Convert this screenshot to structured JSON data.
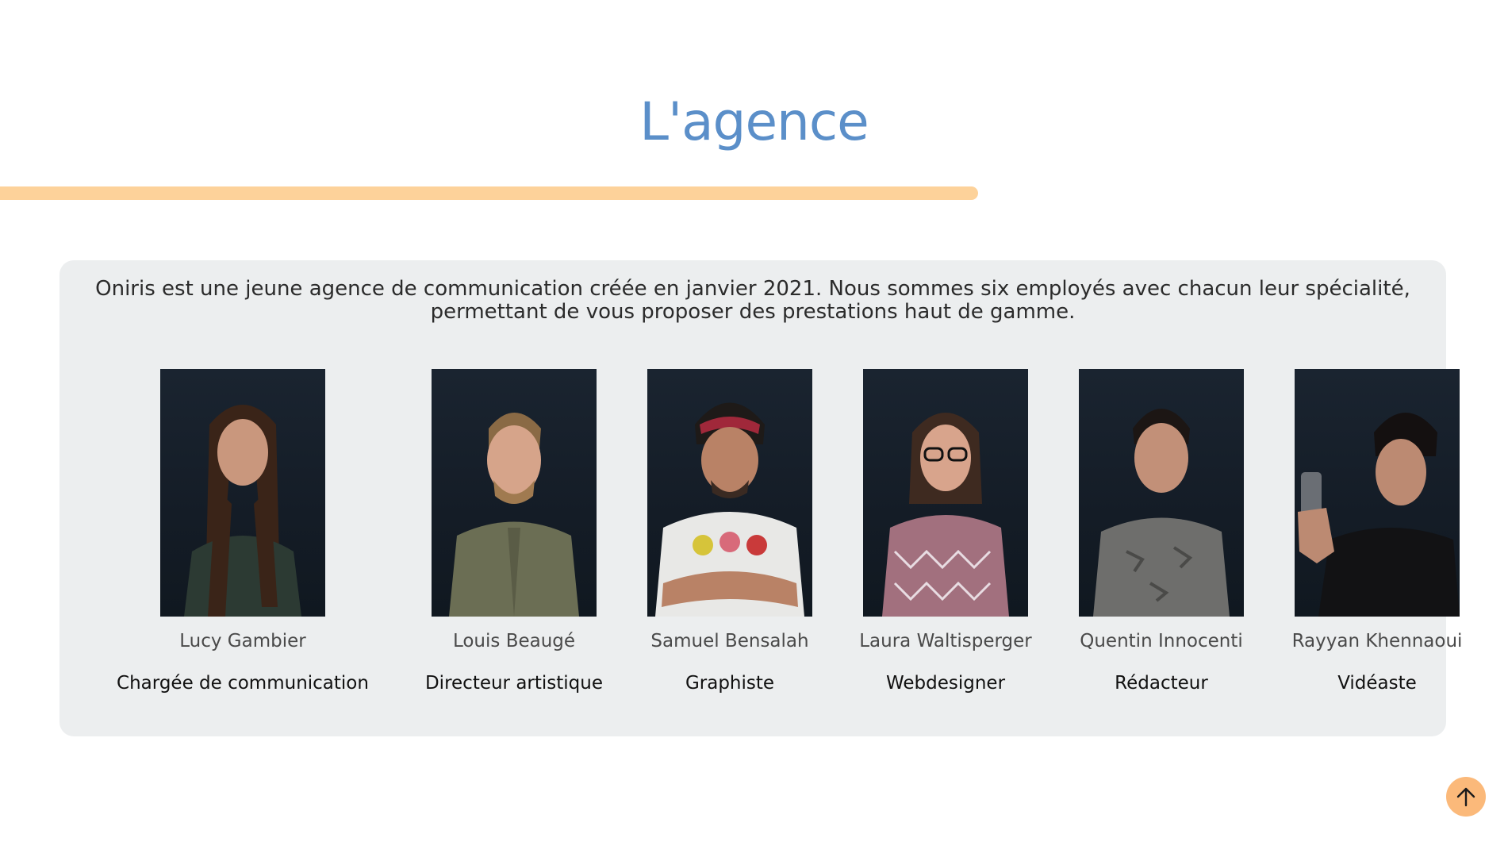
{
  "section": {
    "title": "L'agence",
    "intro": "Oniris est une jeune agence de communication créée en janvier 2021. Nous sommes six employés avec chacun leur spécialité, permettant de vous proposer des prestations haut de gamme."
  },
  "team": [
    {
      "name": "Lucy Gambier",
      "role": "Chargée de communication",
      "photo_alt": "portrait-lucy-gambier"
    },
    {
      "name": "Louis Beaugé",
      "role": "Directeur artistique",
      "photo_alt": "portrait-louis-beauge"
    },
    {
      "name": "Samuel Bensalah",
      "role": "Graphiste",
      "photo_alt": "portrait-samuel-bensalah"
    },
    {
      "name": "Laura Waltisperger",
      "role": "Webdesigner",
      "photo_alt": "portrait-laura-waltisperger"
    },
    {
      "name": "Quentin Innocenti",
      "role": "Rédacteur",
      "photo_alt": "portrait-quentin-innocenti"
    },
    {
      "name": "Rayyan Khennaoui",
      "role": "Vidéaste",
      "photo_alt": "portrait-rayyan-khennaoui"
    }
  ],
  "scroll_top": {
    "icon": "arrow-up-icon",
    "color": "#fbb97a"
  },
  "colors": {
    "title": "#5b8fc9",
    "accent_bar": "#fdd29a",
    "card_background": "#eceeef"
  }
}
